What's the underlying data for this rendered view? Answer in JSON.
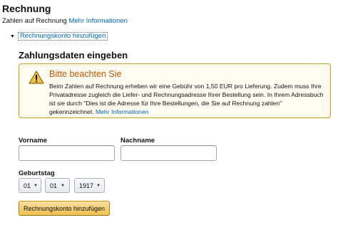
{
  "section": {
    "title": "Rechnung",
    "subtitle": "Zahlen auf Rechnung",
    "more_info_link": "Mehr Informationen"
  },
  "toggle": {
    "icon": "caret-down-icon",
    "label": "Rechnungskonto hinzufügen"
  },
  "form": {
    "title": "Zahlungsdaten eingeben",
    "alert": {
      "icon": "warning-triangle-icon",
      "title": "Bitte beachten Sie",
      "body": "Beim Zahlen auf Rechnung erheben wir eine Gebühr von 1,50 EUR pro Lieferung. Zudem muss Ihre Privatadresse zugleich die Liefer- und Rechnungsadresse Ihrer Bestellung sein. In Ihrem Adressbuch ist sie durch \"Dies ist die Adresse für Ihre Bestellungen, die Sie auf Rechnung zahlen\" gekennzeichnet.",
      "link": "Mehr Informationen",
      "border_color": "#c59f29",
      "title_color": "#c45500"
    },
    "first_name_label": "Vorname",
    "first_name_value": "",
    "last_name_label": "Nachname",
    "last_name_value": "",
    "birthday_label": "Geburtstag",
    "birthday": {
      "day": "01",
      "month": "01",
      "year": "1917"
    },
    "submit_label": "Rechnungskonto hinzufügen"
  },
  "colors": {
    "link": "#0066c0",
    "button_primary": "#f0c14b"
  }
}
